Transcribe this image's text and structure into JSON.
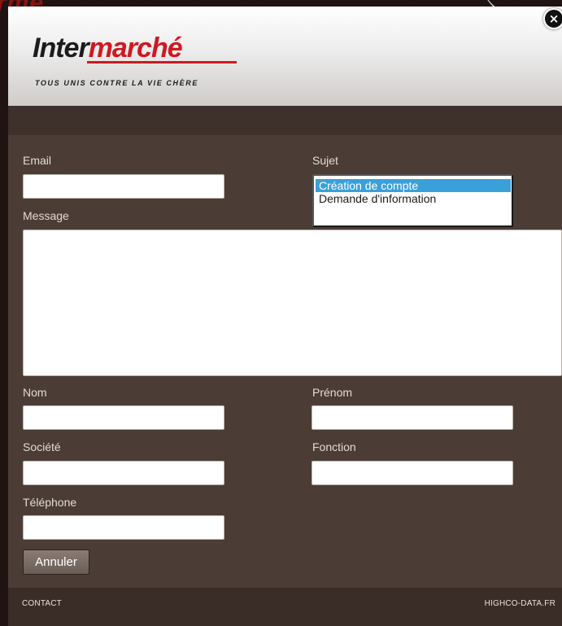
{
  "brand": {
    "logo_part1": "Inter",
    "logo_part2": "marché",
    "tagline": "TOUS UNIS CONTRE LA VIE CHÈRE",
    "background_text": "rme",
    "color_primary": "#d01820"
  },
  "close_button": {
    "label": "×",
    "icon": "close-icon"
  },
  "form": {
    "email_label": "Email",
    "email_value": "",
    "subject_label": "Sujet",
    "subject_options": [
      "Création de compte",
      "Demande d'information"
    ],
    "subject_selected_index": 0,
    "message_label": "Message",
    "message_value": "",
    "last_name_label": "Nom",
    "last_name_value": "",
    "first_name_label": "Prénom",
    "first_name_value": "",
    "company_label": "Société",
    "company_value": "",
    "job_label": "Fonction",
    "job_value": "",
    "phone_label": "Téléphone",
    "phone_value": "",
    "cancel_label": "Annuler"
  },
  "footer": {
    "left_text": "CONTACT",
    "right_text": "HIGHCO-DATA.FR"
  },
  "colors": {
    "modal_bg": "#4b3d35",
    "selection": "#3aa0d9"
  }
}
